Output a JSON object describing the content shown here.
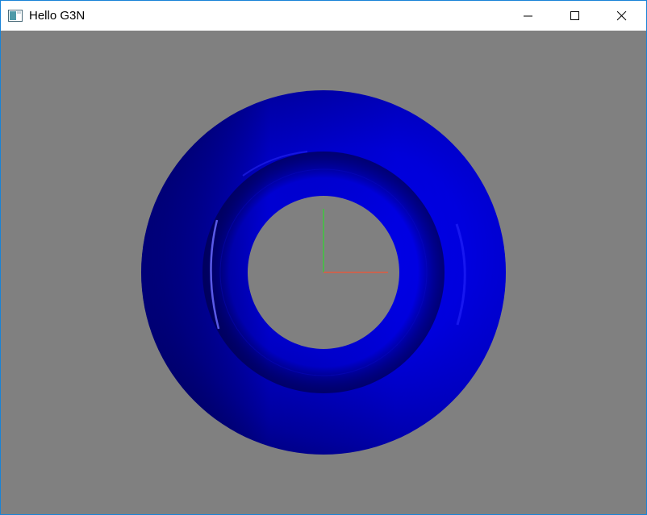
{
  "window": {
    "title": "Hello G3N"
  },
  "icons": {
    "app": "app-window-icon",
    "minimize": "minimize-icon",
    "maximize": "maximize-icon",
    "close": "close-icon"
  },
  "scene": {
    "background_color": "#808080",
    "torus_color": "#0000ff",
    "axis_x_color": "#ff0000",
    "axis_y_color": "#00ff00"
  }
}
